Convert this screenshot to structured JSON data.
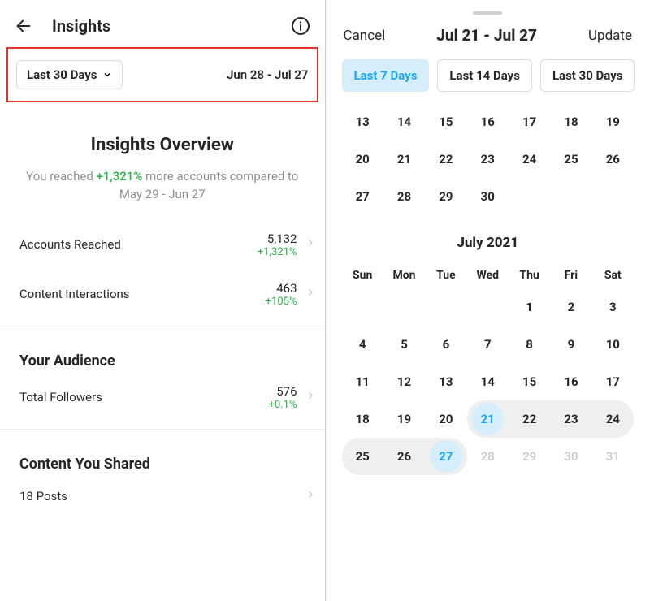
{
  "left": {
    "title": "Insights",
    "range_selector_label": "Last 30 Days",
    "range_date_text": "Jun 28 - Jul 27",
    "overview": {
      "title": "Insights Overview",
      "subline_prefix": "You reached ",
      "subline_delta": "+1,321%",
      "subline_suffix": " more accounts compared to May 29 - Jun 27"
    },
    "metrics": [
      {
        "label": "Accounts Reached",
        "value": "5,132",
        "delta": "+1,321%"
      },
      {
        "label": "Content Interactions",
        "value": "463",
        "delta": "+105%"
      }
    ],
    "audience_title": "Your Audience",
    "audience_metric": {
      "label": "Total Followers",
      "value": "576",
      "delta": "+0.1%"
    },
    "content_title": "Content You Shared",
    "content_row_label": "18 Posts"
  },
  "right": {
    "cancel": "Cancel",
    "update": "Update",
    "title": "Jul 21 - Jul 27",
    "chips": [
      "Last 7 Days",
      "Last 14 Days",
      "Last 30 Days"
    ],
    "active_chip_index": 0,
    "prev_month_trailing_rows": [
      [
        13,
        14,
        15,
        16,
        17,
        18,
        19
      ],
      [
        20,
        21,
        22,
        23,
        24,
        25,
        26
      ],
      [
        27,
        28,
        29,
        30,
        null,
        null,
        null
      ]
    ],
    "month_title": "July 2021",
    "dow": [
      "Sun",
      "Mon",
      "Tue",
      "Wed",
      "Thu",
      "Fri",
      "Sat"
    ],
    "july_days": [
      {
        "d": null
      },
      {
        "d": null
      },
      {
        "d": null
      },
      {
        "d": null
      },
      {
        "d": 1
      },
      {
        "d": 2
      },
      {
        "d": 3
      },
      {
        "d": 4
      },
      {
        "d": 5
      },
      {
        "d": 6
      },
      {
        "d": 7
      },
      {
        "d": 8
      },
      {
        "d": 9
      },
      {
        "d": 10
      },
      {
        "d": 11
      },
      {
        "d": 12
      },
      {
        "d": 13
      },
      {
        "d": 14
      },
      {
        "d": 15
      },
      {
        "d": 16
      },
      {
        "d": 17
      },
      {
        "d": 18
      },
      {
        "d": 19
      },
      {
        "d": 20
      },
      {
        "d": 21,
        "sel": true,
        "range": "start"
      },
      {
        "d": 22,
        "range": "mid"
      },
      {
        "d": 23,
        "range": "mid"
      },
      {
        "d": 24,
        "range": "endrow"
      },
      {
        "d": 25,
        "range": "startrow"
      },
      {
        "d": 26,
        "range": "mid"
      },
      {
        "d": 27,
        "sel": true,
        "range": "end"
      },
      {
        "d": 28,
        "off": true
      },
      {
        "d": 29,
        "off": true
      },
      {
        "d": 30,
        "off": true
      },
      {
        "d": 31,
        "off": true
      }
    ]
  }
}
